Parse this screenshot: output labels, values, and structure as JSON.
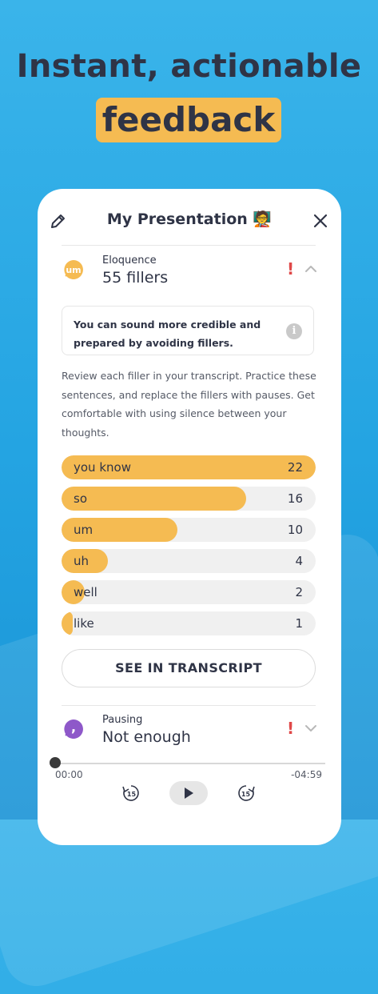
{
  "headline": {
    "line1": "Instant, actionable",
    "line2": "feedback"
  },
  "card": {
    "title": "My Presentation 🧑‍🏫",
    "eloquence": {
      "avatar_text": "um",
      "label": "Eloquence",
      "value": "55 fillers",
      "alert": "!",
      "tip": "You can sound more credible and prepared by avoiding fillers.",
      "info_icon": "i",
      "description": "Review each filler in your transcript. Practice these sentences, and replace the fillers with pauses. Get comfortable with using silence between your thoughts.",
      "max_count": 22,
      "fillers": [
        {
          "word": "you know",
          "count": 22
        },
        {
          "word": "so",
          "count": 16
        },
        {
          "word": "um",
          "count": 10
        },
        {
          "word": "uh",
          "count": 4
        },
        {
          "word": "well",
          "count": 2
        },
        {
          "word": "like",
          "count": 1
        }
      ],
      "button_label": "SEE IN TRANSCRIPT"
    },
    "pausing": {
      "avatar_text": ",",
      "label": "Pausing",
      "value": "Not enough",
      "alert": "!"
    },
    "player": {
      "elapsed": "00:00",
      "remaining": "-04:59",
      "skip_back": "15",
      "skip_forward": "15"
    }
  },
  "colors": {
    "accent": "#f5bb52",
    "alert": "#e04848",
    "pausing": "#8e58c9",
    "text": "#2f3446"
  }
}
